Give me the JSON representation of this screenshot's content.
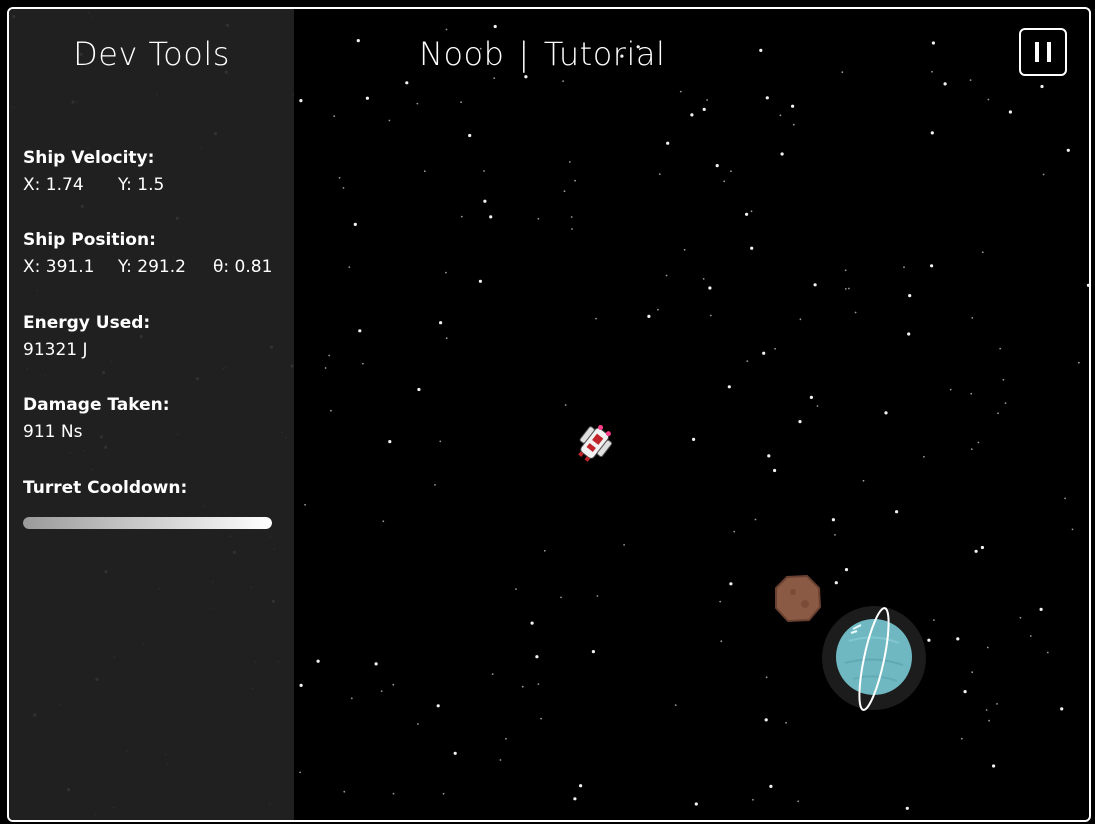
{
  "sidebar": {
    "title": "Dev Tools",
    "velocity": {
      "label": "Ship Velocity:",
      "x": "X: 1.74",
      "y": "Y: 1.5"
    },
    "position": {
      "label": "Ship Position:",
      "x": "X: 391.1",
      "y": "Y: 291.2",
      "theta": "θ: 0.81"
    },
    "energy": {
      "label": "Energy Used:",
      "value": "91321 J"
    },
    "damage": {
      "label": "Damage Taken:",
      "value": "911 Ns"
    },
    "cooldown": {
      "label": "Turret Cooldown:",
      "progress": 1.0
    }
  },
  "header": {
    "player": "Noob",
    "separator": "|",
    "level": "Tutorial"
  },
  "controls": {
    "pause_icon": "pause-icon"
  },
  "scene": {
    "ship_icon": "spaceship-icon",
    "asteroid_icon": "asteroid-icon",
    "planet_icon": "ringed-planet-icon",
    "colors": {
      "planet": "#6fb8c2",
      "asteroid": "#8a5a44",
      "sidebar": "#222222"
    }
  }
}
